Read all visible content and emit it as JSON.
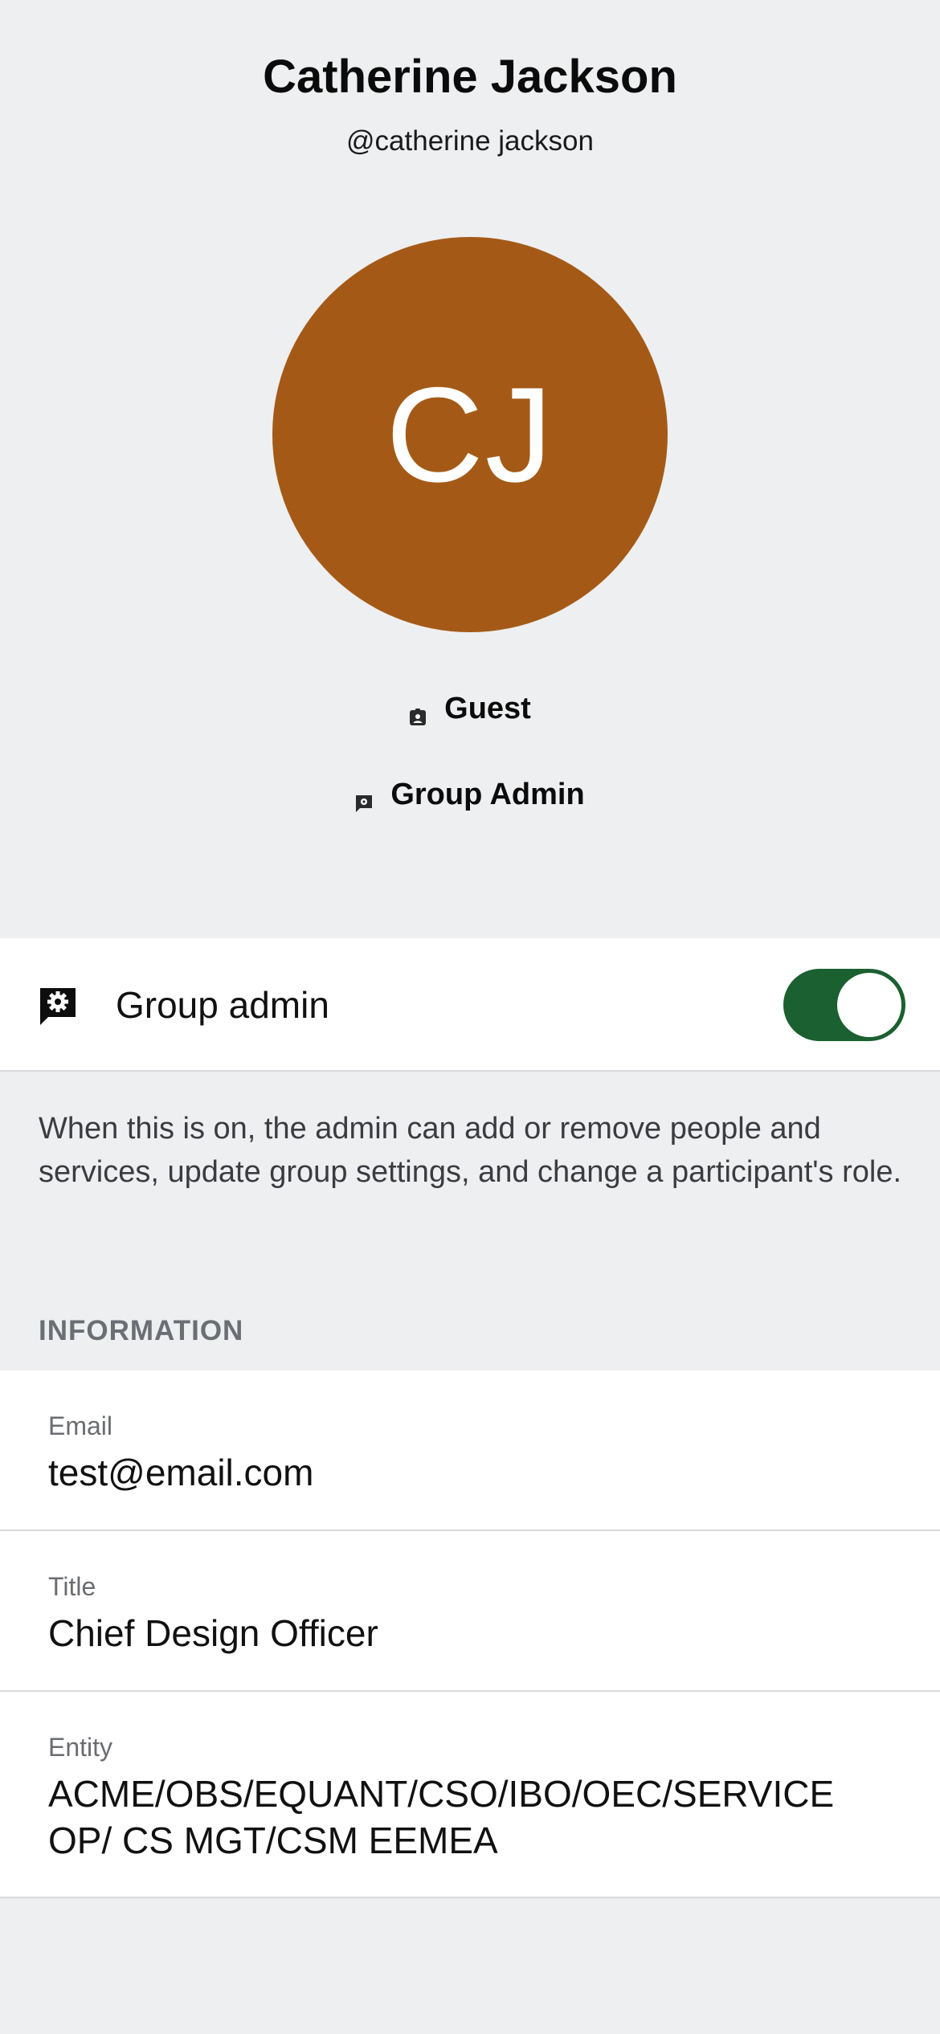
{
  "profile": {
    "name": "Catherine Jackson",
    "handle": "@catherine jackson",
    "initials": "CJ",
    "avatar_color": "#a45a16",
    "roles": [
      {
        "label": "Guest",
        "icon": "badge-icon"
      },
      {
        "label": "Group Admin",
        "icon": "admin-badge-icon"
      }
    ]
  },
  "settings": {
    "group_admin_label": "Group admin",
    "group_admin_on": true,
    "group_admin_icon": "admin-settings-icon",
    "help_text": "When this is on, the admin can add or remove people and services, update group settings, and change a participant's role.",
    "accent_color": "#1b6030"
  },
  "information": {
    "header": "INFORMATION",
    "fields": [
      {
        "label": "Email",
        "value": "test@email.com"
      },
      {
        "label": "Title",
        "value": "Chief Design Officer"
      },
      {
        "label": "Entity",
        "value": "ACME/OBS/EQUANT/CSO/IBO/OEC/SERVICE OP/ CS MGT/CSM EEMEA"
      }
    ]
  }
}
